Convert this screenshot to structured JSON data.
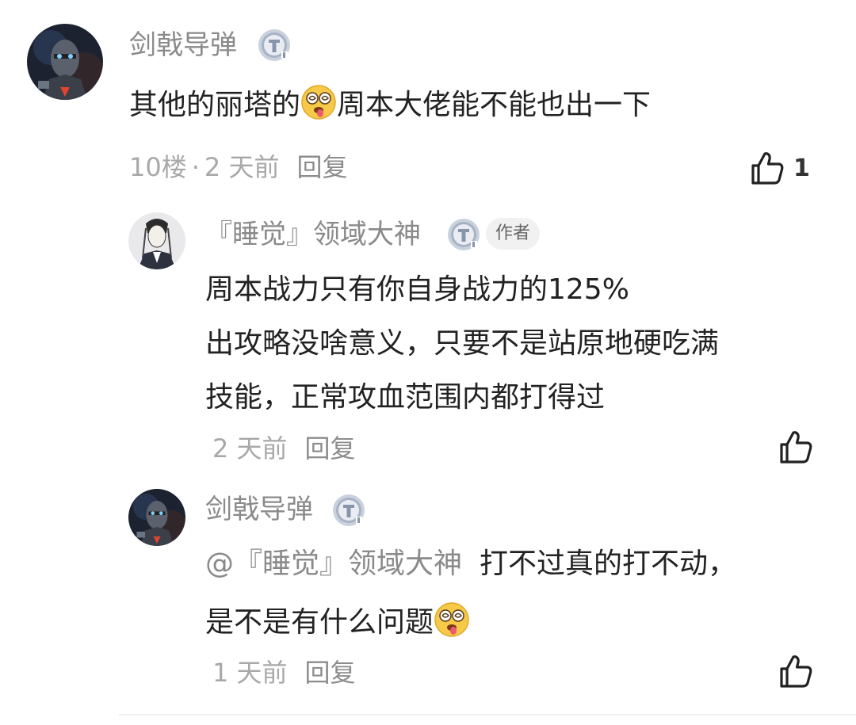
{
  "comment_main": {
    "username": "剑戟导弹",
    "content_before_emoji": "其他的丽塔的",
    "content_after_emoji": "周本大佬能不能也出一下",
    "floor": "10楼",
    "separator": "·",
    "time": "2 天前",
    "reply_label": "回复",
    "like_count": "1"
  },
  "reply_1": {
    "username": "『睡觉』领域大神",
    "author_tag": "作者",
    "lines": [
      "周本战力只有你自身战力的125%",
      "出攻略没啥意义，只要不是站原地硬吃满",
      "技能，正常攻血范围内都打得过"
    ],
    "time": "2 天前",
    "reply_label": "回复"
  },
  "reply_2": {
    "username": "剑戟导弹",
    "mention": "@『睡觉』领域大神",
    "line1_text": "打不过真的打不动，",
    "line2_text": "是不是有什么问题",
    "time": "1 天前",
    "reply_label": "回复"
  },
  "colors": {
    "text_primary": "#222222",
    "text_secondary": "#8a8a8a",
    "text_meta": "#a8a8a8",
    "badge_silver": "#b9c3d2"
  },
  "icons": {
    "level_badge": "level-t-badge-icon",
    "emoji": "dizzy-tongue-emoji-icon",
    "like": "thumbs-up-icon"
  }
}
